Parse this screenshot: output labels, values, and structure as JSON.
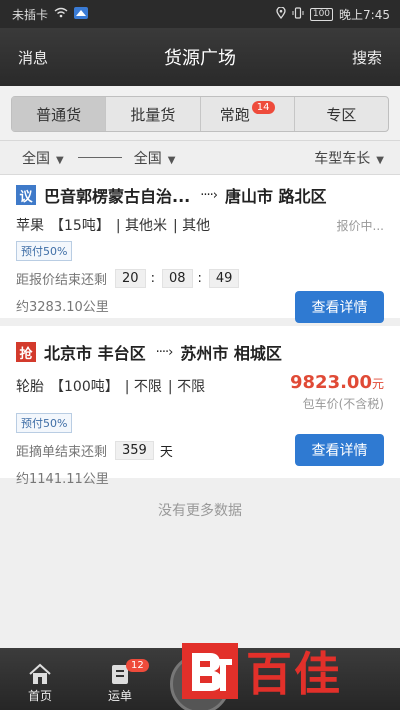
{
  "status_bar": {
    "left": "未插卡",
    "battery": "100",
    "time": "晚上7:45"
  },
  "header": {
    "left": "消息",
    "title": "货源广场",
    "right": "搜索"
  },
  "tabs": [
    {
      "label": "普通货"
    },
    {
      "label": "批量货"
    },
    {
      "label": "常跑",
      "badge": "14"
    },
    {
      "label": "专区"
    }
  ],
  "filters": {
    "from": "全国",
    "to": "全国",
    "vehicle": "车型车长"
  },
  "cards": [
    {
      "tag": "议",
      "from": "巴音郭楞蒙古自治...",
      "to": "唐山市 路北区",
      "goods": [
        "苹果",
        "【15吨】",
        "| 其他米",
        "| 其他"
      ],
      "quote": "报价中...",
      "prepay": "预付50%",
      "timer_label": "距报价结束还剩",
      "timer": [
        "20",
        "08",
        "49"
      ],
      "distance": "约3283.10公里",
      "button": "查看详情"
    },
    {
      "tag": "抢",
      "from": "北京市 丰台区",
      "to": "苏州市 相城区",
      "goods": [
        "轮胎",
        "【100吨】",
        "| 不限",
        "| 不限"
      ],
      "price": "9823.00",
      "price_unit": "元",
      "price_note": "包车价(不含税)",
      "prepay": "预付50%",
      "timer_label": "距摘单结束还剩",
      "days": "359",
      "days_unit": "天",
      "distance": "约1141.11公里",
      "button": "查看详情"
    }
  ],
  "no_more": "没有更多数据",
  "bottom_nav": {
    "home": "首页",
    "orders": "运单",
    "orders_badge": "12"
  },
  "watermark": "百佳",
  "colors": {
    "accent": "#2f7ad2",
    "badge": "#ee4b3b",
    "price": "#e04a36"
  }
}
